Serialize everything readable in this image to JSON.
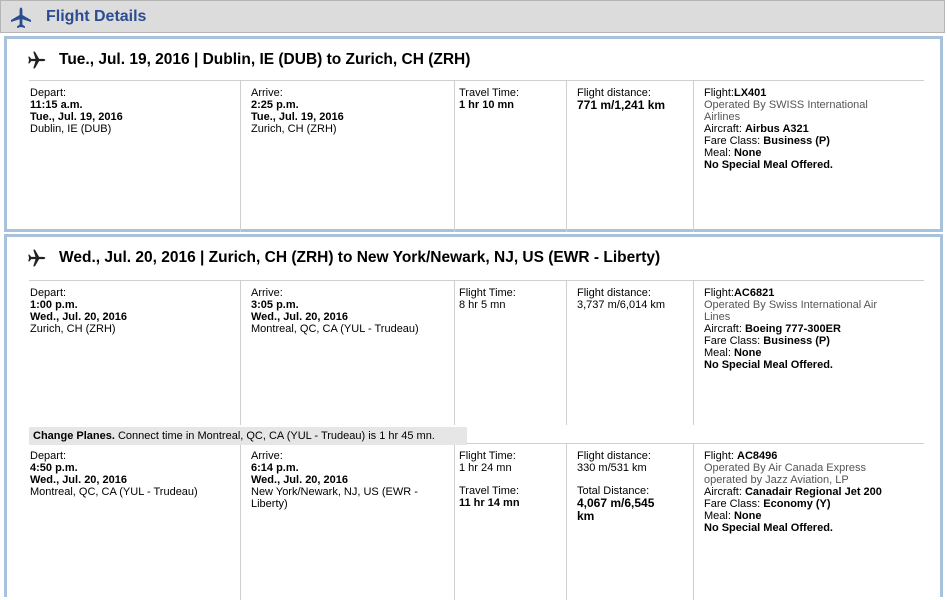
{
  "header": {
    "title": "Flight Details"
  },
  "seg1": {
    "title": "Tue., Jul. 19, 2016 | Dublin, IE (DUB) to Zurich, CH (ZRH)",
    "depart": {
      "label": "Depart:",
      "time": "11:15 a.m.",
      "date": "Tue., Jul. 19, 2016",
      "place": "Dublin, IE (DUB)"
    },
    "arrive": {
      "label": "Arrive:",
      "time": "2:25 p.m.",
      "date": "Tue., Jul. 19, 2016",
      "place": "Zurich, CH (ZRH)"
    },
    "time": {
      "label": "Travel Time:",
      "value": "1 hr 10 mn"
    },
    "distance": {
      "label": "Flight distance:",
      "value": "771 m/1,241 km"
    },
    "info": {
      "flight_label": "Flight:",
      "flight": "LX401",
      "operated1": "Operated By SWISS International",
      "operated2": "Airlines",
      "aircraft_label": "Aircraft: ",
      "aircraft": "Airbus A321",
      "fare_label": "Fare Class: ",
      "fare": "Business (P)",
      "meal_label": "Meal: ",
      "meal": "None",
      "special": "No Special Meal Offered."
    }
  },
  "seg2": {
    "title": "Wed., Jul. 20, 2016 | Zurich, CH (ZRH) to New York/Newark, NJ, US (EWR - Liberty)",
    "leg1": {
      "depart": {
        "label": "Depart:",
        "time": "1:00 p.m.",
        "date": "Wed., Jul. 20, 2016",
        "place": "Zurich, CH (ZRH)"
      },
      "arrive": {
        "label": "Arrive:",
        "time": "3:05 p.m.",
        "date": "Wed., Jul. 20, 2016",
        "place": "Montreal, QC, CA (YUL - Trudeau)"
      },
      "time": {
        "label": "Flight Time:",
        "value": "8 hr 5 mn"
      },
      "distance": {
        "label": "Flight distance:",
        "value": "3,737 m/6,014 km"
      },
      "info": {
        "flight_label": "Flight:",
        "flight": "AC6821",
        "operated1": "Operated By Swiss International Air",
        "operated2": "Lines",
        "aircraft_label": "Aircraft: ",
        "aircraft": "Boeing 777-300ER",
        "fare_label": "Fare Class: ",
        "fare": "Business (P)",
        "meal_label": "Meal: ",
        "meal": "None",
        "special": "No Special Meal Offered."
      }
    },
    "change": {
      "label": "Change Planes.",
      "text": " Connect time in Montreal, QC, CA (YUL - Trudeau) is 1 hr 45 mn."
    },
    "leg2": {
      "depart": {
        "label": "Depart:",
        "time": "4:50 p.m.",
        "date": "Wed., Jul. 20, 2016",
        "place": "Montreal, QC, CA (YUL - Trudeau)"
      },
      "arrive": {
        "label": "Arrive:",
        "time": "6:14 p.m.",
        "date": "Wed., Jul. 20, 2016",
        "place1": "New York/Newark, NJ, US (EWR -",
        "place2": "Liberty)"
      },
      "time": {
        "label": "Flight Time:",
        "value": "1 hr 24 mn",
        "travel_label": "Travel Time:",
        "travel_value": "11 hr 14 mn"
      },
      "distance": {
        "label": "Flight distance:",
        "value": "330 m/531 km",
        "total_label": "Total Distance:",
        "total_value1": "4,067 m/6,545",
        "total_value2": "km"
      },
      "info": {
        "flight_label": "Flight: ",
        "flight": "AC8496",
        "operated1": "Operated By Air Canada Express",
        "operated2": "operated by Jazz Aviation, LP",
        "aircraft_label": "Aircraft: ",
        "aircraft": "Canadair Regional Jet 200",
        "fare_label": "Fare Class: ",
        "fare": "Economy (Y)",
        "meal_label": "Meal: ",
        "meal": "None",
        "special": "No Special Meal Offered."
      }
    }
  }
}
